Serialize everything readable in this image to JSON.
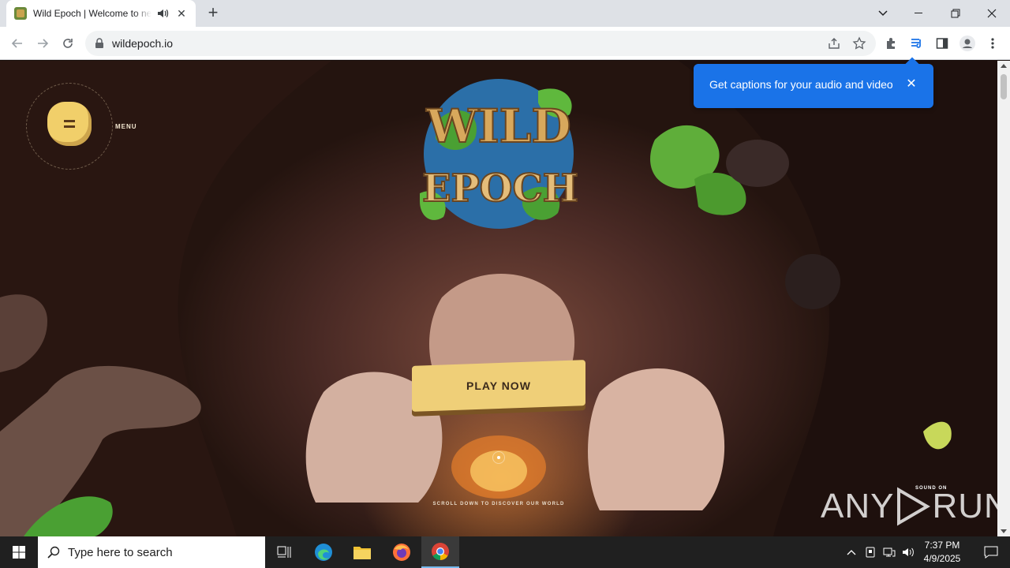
{
  "browser": {
    "tab_title": "Wild Epoch | Welcome to new",
    "url": "wildepoch.io",
    "captions_popup": "Get captions for your audio and video"
  },
  "page": {
    "menu_label": "MENU",
    "logo_line1": "WILD",
    "logo_line2": "EPOCH",
    "play_button": "PLAY NOW",
    "scroll_hint": "SCROLL DOWN TO DISCOVER OUR WORLD",
    "sound_label": "SOUND ON",
    "watermark_left": "ANY",
    "watermark_right": "RUN"
  },
  "taskbar": {
    "search_placeholder": "Type here to search",
    "time": "7:37 PM",
    "date": "4/9/2025"
  },
  "colors": {
    "accent": "#1a73e8",
    "play_button": "#efcf78",
    "menu_button": "#f1cf6a"
  }
}
